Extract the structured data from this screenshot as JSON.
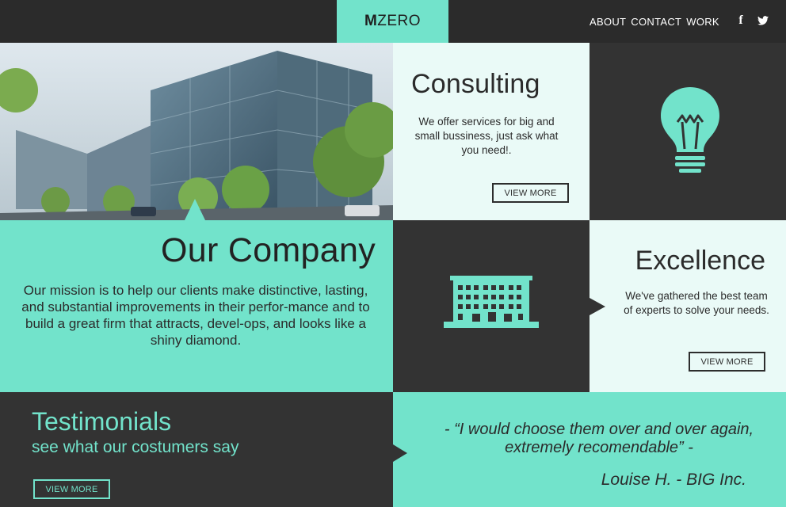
{
  "brand": {
    "logo_m": "M",
    "logo_rest": "ZERO"
  },
  "nav": {
    "items": [
      "ABOUT",
      "CONTACT",
      "WORK"
    ]
  },
  "social": {
    "facebook": "f",
    "twitter": "twitter-icon"
  },
  "colors": {
    "accent": "#72e3cb",
    "light": "#eafaf7",
    "dark": "#333333"
  },
  "consulting": {
    "title": "Consulting",
    "text": "We offer services for big and small bussiness, just ask what you need!.",
    "button": "VIEW MORE"
  },
  "company": {
    "title": "Our Company",
    "text": "Our mission is to help our clients make distinctive, lasting, and substantial improvements in their perfor-mance and to build a great firm that attracts, devel-ops, and looks like a shiny diamond."
  },
  "excellence": {
    "title": "Excellence",
    "text": "We've gathered the best team of experts to solve your needs.",
    "button": "VIEW MORE"
  },
  "testimonials": {
    "title": "Testimonials",
    "subtitle": "see what our costumers say",
    "button": "VIEW MORE",
    "quote": "- “I would choose them over and over again, extremely recomendable” -",
    "author": "Louise H. - BIG Inc."
  }
}
